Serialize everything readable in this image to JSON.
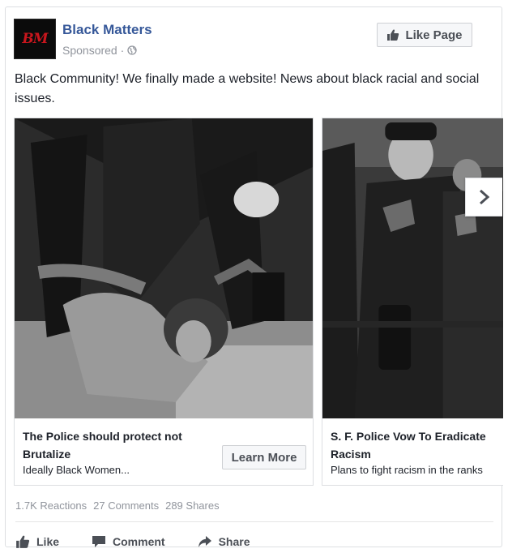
{
  "post": {
    "page_name": "Black Matters",
    "avatar_text": "BM",
    "sponsored": "Sponsored ·",
    "like_page_label": "Like Page",
    "caption": "Black Community! We finally made a website! News about black racial and social issues."
  },
  "carousel": {
    "cards": [
      {
        "title": "The Police should protect not Brutalize",
        "description": "Ideally Black Women...",
        "cta": "Learn More"
      },
      {
        "title": "S. F. Police Vow To Eradicate Racism",
        "description": "Plans to fight racism in the ranks"
      }
    ]
  },
  "stats": {
    "reactions": "1.7K Reactions",
    "comments": "27 Comments",
    "shares": "289 Shares"
  },
  "actions": {
    "like": "Like",
    "comment": "Comment",
    "share": "Share"
  },
  "icons": {
    "thumbs_up": "thumbs-up-icon",
    "globe": "globe-icon",
    "comment": "comment-icon",
    "share": "share-icon",
    "next": "chevron-right-icon"
  },
  "colors": {
    "page_name": "#365899",
    "secondary_text": "#90949c",
    "button_text": "#4b4f56",
    "avatar_text": "#c8161d"
  }
}
